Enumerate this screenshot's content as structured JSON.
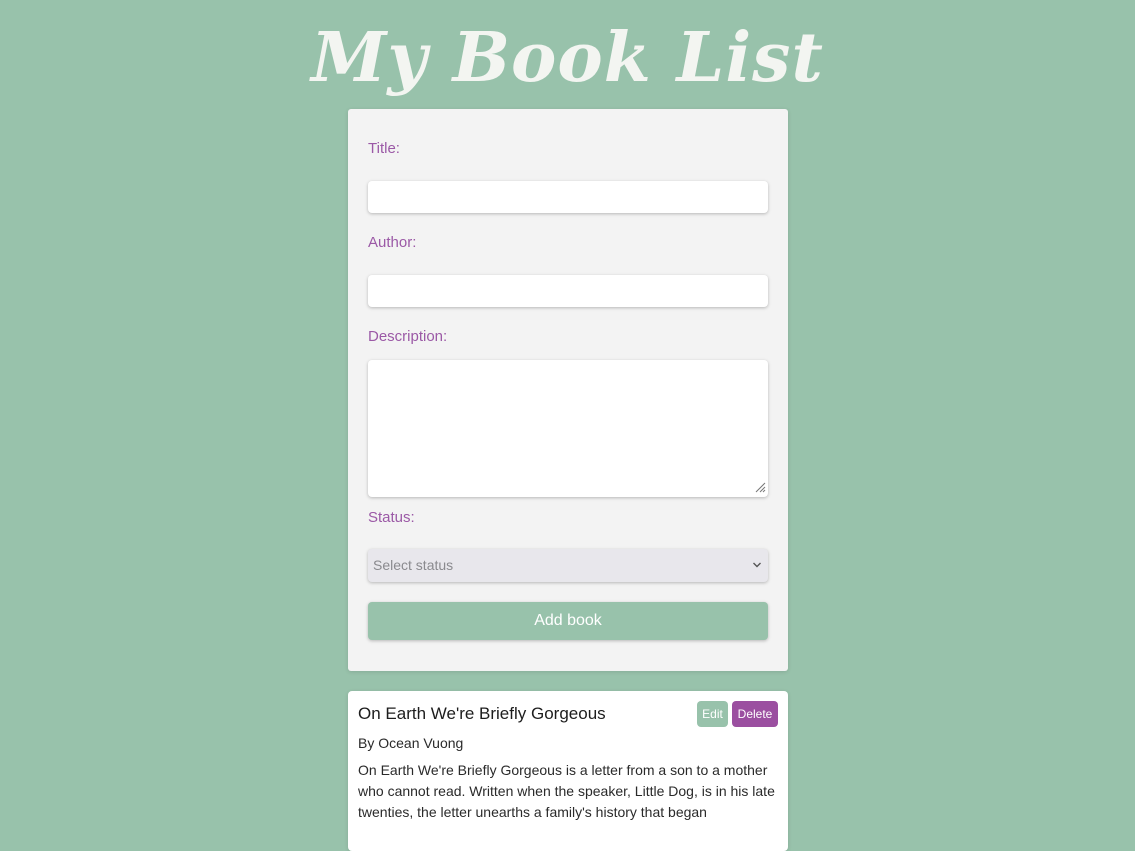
{
  "header": {
    "title": "My Book List"
  },
  "form": {
    "title_label": "Title:",
    "title_value": "",
    "author_label": "Author:",
    "author_value": "",
    "description_label": "Description:",
    "description_value": "",
    "status_label": "Status:",
    "status_selected": "Select status",
    "submit_label": "Add book"
  },
  "books": [
    {
      "title": "On Earth We're Briefly Gorgeous",
      "author": "By Ocean Vuong",
      "description": "On Earth We're Briefly Gorgeous is a letter from a son to a mother who cannot read. Written when the speaker, Little Dog, is in his late twenties, the letter unearths a family's history that began",
      "edit_label": "Edit",
      "delete_label": "Delete"
    }
  ],
  "colors": {
    "background": "#98c2ab",
    "accent_purple": "#9b4fa0",
    "card": "#f3f3f3"
  }
}
